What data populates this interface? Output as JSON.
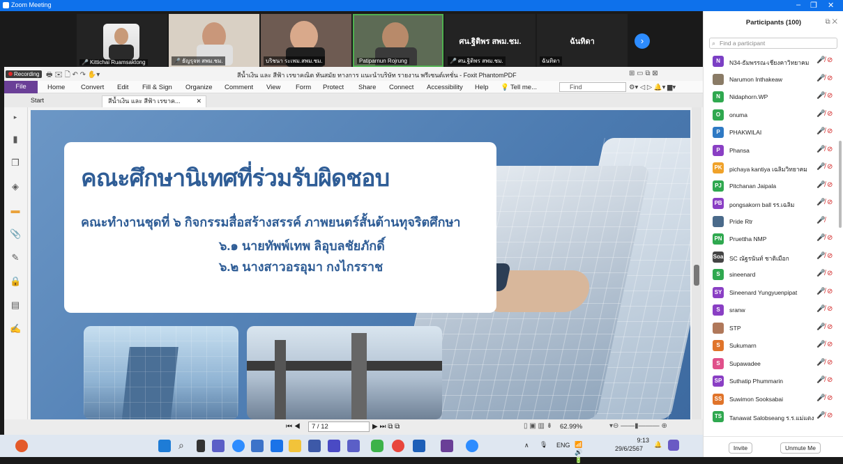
{
  "window": {
    "title": "Zoom Meeting"
  },
  "video_tiles": [
    {
      "name": "Kittichai Ruamsaktong",
      "muted": true
    },
    {
      "name": "ธัญรุจท สพม.ชม.",
      "muted": true
    },
    {
      "name": "บริชนา ระเพม.สพม.ชม.",
      "muted": false
    },
    {
      "name": "Patiparnun Rojrung",
      "muted": true
    },
    {
      "name": "ศน.ฐิติพร สพม.ชม.",
      "muted": true,
      "video_off": true
    },
    {
      "name": "ฉันทิดา",
      "muted": false,
      "video_off": true
    }
  ],
  "foxit": {
    "recording_label": "Recording",
    "doc_title": "สีน้ำเงิน และ สีฟ้า เรขาคณิต ทันสมัย ทางการ แนะนำบริษัท รายงาน พรีเซนต์เทชั่น - Foxit PhantomPDF",
    "menu": [
      "File",
      "Home",
      "Convert",
      "Edit",
      "Fill & Sign",
      "Organize",
      "Comment",
      "View",
      "Form",
      "Protect",
      "Share",
      "Connect",
      "Accessibility",
      "Help"
    ],
    "tell_me": "Tell me...",
    "search_placeholder": "Find",
    "tabs": [
      "Start",
      "สีน้ำเงิน และ สีฟ้า เรขาค..."
    ],
    "page_indicator": "7 / 12",
    "zoom": "62.99%"
  },
  "slide": {
    "title": "คณะศึกษานิเทศที่ร่วมรับผิดชอบ",
    "subtitle": "คณะทำงานชุดที่ ๖ กิจกรรมสื่อสร้างสรรค์ ภาพยนตร์สั้นต้านทุจริตศึกษา",
    "member1": "๖.๑ นายทัพพ์เทพ      ลิอุบลชัยภักดิ์",
    "member2": "๖.๒ นางสาวอรอุมา      กงไกรราช"
  },
  "taskbar": {
    "lang": "ENG",
    "time": "9:13",
    "date": "29/6/2567"
  },
  "participants": {
    "header": "Participants (100)",
    "search_placeholder": "Find a participant",
    "items": [
      {
        "initials": "N",
        "name": "N34-ธัมพรรณ-เชียงคาวิทยาคม",
        "color": "#7b3fc4",
        "cam_off": true
      },
      {
        "initials": "",
        "name": "Narumon Inthakeaw",
        "color": "#8a7b66",
        "cam_off": true
      },
      {
        "initials": "N",
        "name": "Nidaphorn.WP",
        "color": "#2fa84f",
        "cam_off": true
      },
      {
        "initials": "O",
        "name": "onuma",
        "color": "#2fa84f",
        "cam_off": true
      },
      {
        "initials": "P",
        "name": "PHAKWILAI",
        "color": "#2f7ac4",
        "cam_off": true
      },
      {
        "initials": "P",
        "name": "Phansa",
        "color": "#8a3fc4",
        "cam_off": true
      },
      {
        "initials": "PK",
        "name": "pichaya kantiya เฉลิมวิทยาคม",
        "color": "#f0a22a",
        "cam_off": true
      },
      {
        "initials": "PJ",
        "name": "Pitchanan Jaipala",
        "color": "#2fa84f",
        "cam_off": true
      },
      {
        "initials": "PB",
        "name": "pongsakorn ball รร.เฉลิม",
        "color": "#8a3fc4",
        "cam_off": true
      },
      {
        "initials": "",
        "name": "Pride Rtr",
        "color": "#4a6a8a",
        "cam_off": false
      },
      {
        "initials": "PN",
        "name": "Pruettha NMP",
        "color": "#2fa84f",
        "cam_off": true
      },
      {
        "initials": "Soa",
        "name": "SC ณัฐรนันท์ ชาติเมือก",
        "color": "#444444",
        "cam_off": true
      },
      {
        "initials": "S",
        "name": "sineenard",
        "color": "#2fa84f",
        "cam_off": true
      },
      {
        "initials": "SY",
        "name": "Sineenard Yungyuenpipat",
        "color": "#8a3fc4",
        "cam_off": true
      },
      {
        "initials": "S",
        "name": "sranw",
        "color": "#8a3fc4",
        "cam_off": true
      },
      {
        "initials": "",
        "name": "STP",
        "color": "#b0785a",
        "cam_off": true
      },
      {
        "initials": "S",
        "name": "Sukumarn",
        "color": "#e0742a",
        "cam_off": true
      },
      {
        "initials": "S",
        "name": "Supawadee",
        "color": "#e0508a",
        "cam_off": true
      },
      {
        "initials": "SP",
        "name": "Suthatip Phummarin",
        "color": "#8a3fc4",
        "cam_off": true
      },
      {
        "initials": "SS",
        "name": "Suwimon Sooksabai",
        "color": "#e0742a",
        "cam_off": true
      },
      {
        "initials": "TS",
        "name": "Tanawat Salobseang ร.ร.แม่แตง",
        "color": "#2fa84f",
        "cam_off": true
      }
    ],
    "invite_label": "Invite",
    "unmute_label": "Unmute Me"
  }
}
